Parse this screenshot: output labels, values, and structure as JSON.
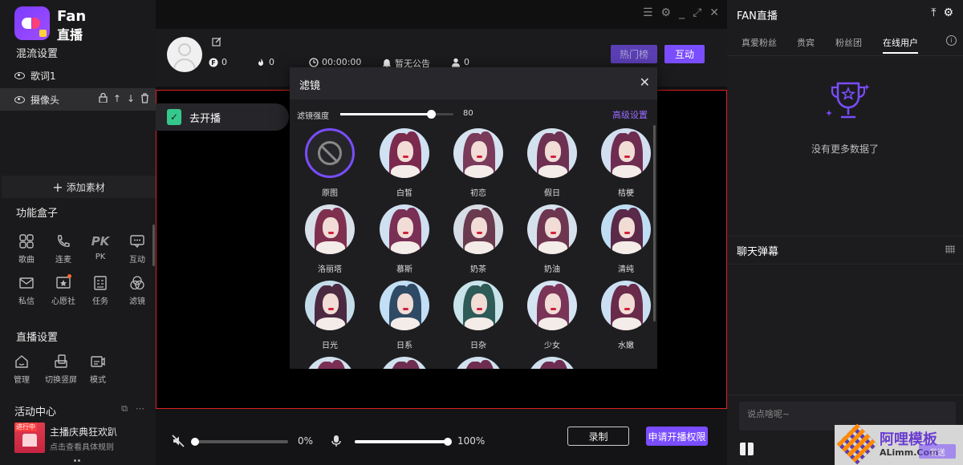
{
  "app": {
    "brand_line1": "Fan",
    "brand_line2": "直播"
  },
  "left": {
    "mix_title": "混流设置",
    "layers": [
      {
        "label": "歌词1",
        "selected": false
      },
      {
        "label": "摄像头",
        "selected": true
      }
    ],
    "add_material": "添加素材",
    "func_box_title": "功能盒子",
    "func_items": [
      {
        "label": "歌曲",
        "icon": "music-grid-icon"
      },
      {
        "label": "连麦",
        "icon": "phone-icon"
      },
      {
        "label": "PK",
        "icon": "pk-icon"
      },
      {
        "label": "互动",
        "icon": "chat-bubble-icon"
      },
      {
        "label": "私信",
        "icon": "mail-icon"
      },
      {
        "label": "心愿社",
        "icon": "wish-icon",
        "badge": true
      },
      {
        "label": "任务",
        "icon": "task-icon"
      },
      {
        "label": "滤镜",
        "icon": "filter-icon"
      }
    ],
    "live_settings_title": "直播设置",
    "live_items": [
      {
        "label": "管理",
        "icon": "house-icon"
      },
      {
        "label": "切换竖屏",
        "icon": "rotate-screen-icon"
      },
      {
        "label": "模式",
        "icon": "mode-icon"
      }
    ],
    "activity_title": "活动中心",
    "activity": {
      "tag": "进行中",
      "name": "主播庆典狂欢趴",
      "desc": "点击查看具体规则"
    }
  },
  "center": {
    "stats": [
      {
        "icon": "coin-icon",
        "value": "0"
      },
      {
        "icon": "fire-icon",
        "value": "0"
      },
      {
        "icon": "clock-icon",
        "value": "00:00:00"
      },
      {
        "icon": "bell-icon",
        "value": "暂无公告"
      },
      {
        "icon": "user-icon",
        "value": "0"
      }
    ],
    "hot_btn": "热门榜",
    "interact_btn": "互动",
    "go_live": "去开播",
    "volume_pct": "0%",
    "volume_value": 0,
    "mic_pct": "100%",
    "mic_value": 100,
    "record_btn": "录制",
    "apply_btn": "申请开播权限"
  },
  "filter_modal": {
    "title": "滤镜",
    "intensity_label": "滤镜强度",
    "intensity_value": 80,
    "intensity_text": "80",
    "advanced": "高级设置",
    "filters": [
      {
        "label": "原图",
        "original": true
      },
      {
        "label": "白皙",
        "hair": "#7b2a4e",
        "bg": "#cfe1f2"
      },
      {
        "label": "初恋",
        "hair": "#7a3a5a",
        "bg": "#d6e3f0"
      },
      {
        "label": "假日",
        "hair": "#6f3152",
        "bg": "#d3e0ee"
      },
      {
        "label": "桔梗",
        "hair": "#6e2d50",
        "bg": "#d2dff0"
      },
      {
        "label": "洛丽塔",
        "hair": "#80304f",
        "bg": "#d8e0ea"
      },
      {
        "label": "慕斯",
        "hair": "#7a2f55",
        "bg": "#cfe0f0"
      },
      {
        "label": "奶茶",
        "hair": "#6a3a4e",
        "bg": "#d7dde4"
      },
      {
        "label": "奶油",
        "hair": "#6e3550",
        "bg": "#d5e2ee"
      },
      {
        "label": "清纯",
        "hair": "#5a2a48",
        "bg": "#bfdef4"
      },
      {
        "label": "日光",
        "hair": "#4b2940",
        "bg": "#c4dcea"
      },
      {
        "label": "日系",
        "hair": "#2f4a64",
        "bg": "#c2dff5"
      },
      {
        "label": "日杂",
        "hair": "#2e5a58",
        "bg": "#c9e3ea"
      },
      {
        "label": "少女",
        "hair": "#7a3458",
        "bg": "#d4e4f3"
      },
      {
        "label": "水嫩",
        "hair": "#6a2a4a",
        "bg": "#cadff2"
      },
      {
        "label": "",
        "hair": "#7a2f55",
        "bg": "#d0e0ee"
      },
      {
        "label": "",
        "hair": "#6e2d50",
        "bg": "#d0e0ee"
      },
      {
        "label": "",
        "hair": "#6e2d50",
        "bg": "#d0e0ee"
      },
      {
        "label": "",
        "hair": "#6e2d50",
        "bg": "#d0e0ee"
      }
    ]
  },
  "right": {
    "title": "FAN直播",
    "tabs": [
      "真爱粉丝",
      "贵宾",
      "粉丝团",
      "在线用户"
    ],
    "active_tab": 3,
    "empty_text": "没有更多数据了",
    "chat_title": "聊天弹幕",
    "chat_placeholder": "说点啥呢~",
    "send_btn": "发送",
    "watermark_line1": "阿哩模板",
    "watermark_line2": "ALimm.Com"
  },
  "colors": {
    "accent": "#7a4dff",
    "stage_border": "#dd2222",
    "panel": "#1c1c1f"
  }
}
